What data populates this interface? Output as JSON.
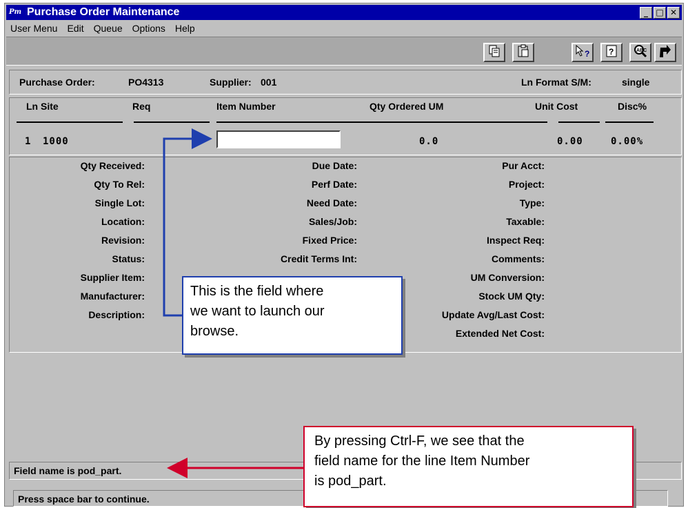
{
  "window": {
    "title": "Purchase Order Maintenance",
    "icon": "app-logo-icon",
    "icon_text": "Pm",
    "controls": {
      "minimize": "_",
      "maximize": "□",
      "close": "✕"
    }
  },
  "menu": [
    "User Menu",
    "Edit",
    "Queue",
    "Options",
    "Help"
  ],
  "toolbar": {
    "buttons": [
      "copy-icon",
      "paste-icon",
      "whats-this-icon",
      "help-icon",
      "spell-check-icon",
      "back-icon"
    ]
  },
  "header": {
    "purchase_order_label": "Purchase Order:",
    "purchase_order_value": "PO4313",
    "supplier_label": "Supplier:",
    "supplier_value": "001",
    "ln_format_label": "Ln Format S/M:",
    "ln_format_value": "single"
  },
  "line_grid": {
    "columns": [
      "Ln Site",
      "Req",
      "Item Number",
      "Qty Ordered UM",
      "Unit Cost",
      "Disc%"
    ],
    "row": {
      "ln": "1",
      "site": "1000",
      "item_number": "",
      "qty_ordered": "0.0",
      "unit_cost": "0.00",
      "disc": "0.00%"
    }
  },
  "detail": {
    "col1": [
      "Qty Received:",
      "Qty To Rel:",
      "Single Lot:",
      "Location:",
      "Revision:",
      "Status:",
      "Supplier Item:",
      "Manufacturer:",
      "Description:"
    ],
    "col2": [
      "Due Date:",
      "Perf Date:",
      "Need Date:",
      "Sales/Job:",
      "Fixed Price:",
      "Credit Terms Int:"
    ],
    "col3": [
      "Pur Acct:",
      "Project:",
      "Type:",
      "Taxable:",
      "Inspect Req:",
      "Comments:",
      "UM Conversion:",
      "Stock UM Qty:",
      "Update Avg/Last Cost:",
      "Extended Net Cost:"
    ]
  },
  "status": {
    "line1": "Field name is pod_part.",
    "line2": "Press space bar to continue."
  },
  "callouts": {
    "blue": [
      "This is the field where",
      "we want to launch our",
      "browse."
    ],
    "red": [
      "By pressing Ctrl-F, we see that the",
      "field name for the line Item Number",
      "is pod_part."
    ]
  },
  "colors": {
    "titlebar": "#0000a8",
    "window": "#c0c0c0",
    "toolbar": "#a8a8a8",
    "callout_blue": "#1f3fae",
    "callout_red": "#d0002a"
  }
}
